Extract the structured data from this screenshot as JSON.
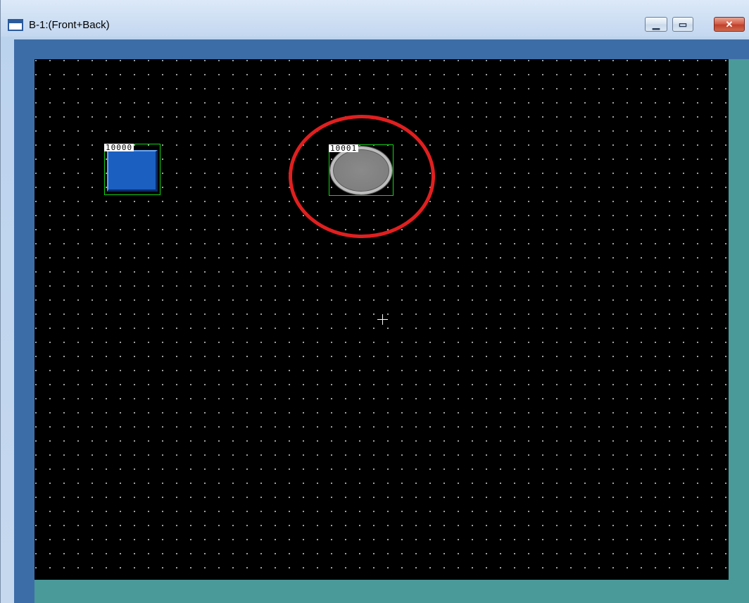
{
  "window": {
    "title": "B-1:(Front+Back)",
    "controls": {
      "minimize_icon": "window-minimize-icon",
      "maximize_icon": "window-maximize-icon",
      "close_icon": "window-close-icon",
      "minimize_glyph": "▁",
      "maximize_glyph": "▭",
      "close_glyph": "✕"
    }
  },
  "canvas": {
    "background_color": "#000000",
    "grid_dot_color": "#b8b8b8",
    "parts": [
      {
        "id_label": "10000",
        "type": "switch",
        "color": "#1b5fc1"
      },
      {
        "id_label": "10001",
        "type": "lamp",
        "color": "#808080"
      }
    ],
    "highlight_color": "#e01f1f",
    "selection_border_color": "#14d214"
  },
  "colors": {
    "frame_blue": "#3d6da6",
    "frame_teal": "#4a9a9a"
  }
}
